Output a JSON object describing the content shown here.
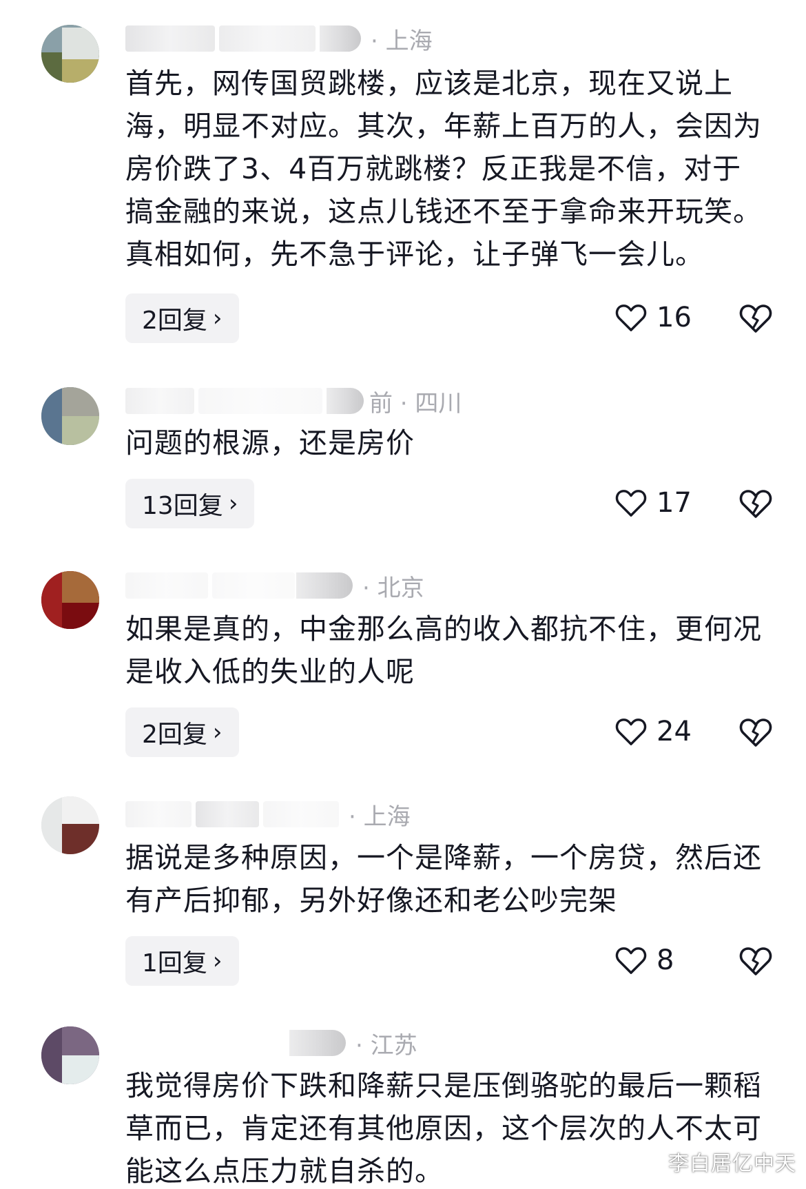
{
  "comments": [
    {
      "location": "· 上海",
      "text_lines": [
        "首先，网传国贸跳楼，应该是北京，现在又说上",
        "海，明显不对应。其次，年薪上百万的人，会因为",
        "房价跌了3、4百万就跳楼？反正我是不信，对于",
        "搞金融的来说，这点儿钱还不至于拿命来开玩笑。",
        "真相如何，先不急于评论，让子弹飞一会儿。"
      ],
      "reply_label": "2回复",
      "likes": "16"
    },
    {
      "location": "前 · 四川",
      "text_lines": [
        "问题的根源，还是房价"
      ],
      "reply_label": "13回复",
      "likes": "17"
    },
    {
      "location": "· 北京",
      "text_lines": [
        "如果是真的，中金那么高的收入都抗不住，更何况",
        "是收入低的失业的人呢"
      ],
      "reply_label": "2回复",
      "likes": "24"
    },
    {
      "location": "· 上海",
      "text_lines": [
        "据说是多种原因，一个是降薪，一个房贷，然后还",
        "有产后抑郁，另外好像还和老公吵完架"
      ],
      "reply_label": "1回复",
      "likes": "8"
    },
    {
      "location": "· 江苏",
      "text_lines": [
        "我觉得房价下跌和降薪只是压倒骆驼的最后一颗稻",
        "草而已，肯定还有其他原因，这个层次的人不太可",
        "能这么点压力就自杀的。"
      ]
    }
  ],
  "icons": {
    "reply_chevron": "chevron-right-icon",
    "like": "heart-outline-icon",
    "dislike": "broken-heart-icon"
  },
  "chevron_glyph": "›",
  "watermark": "李白居亿中天",
  "colors": {
    "text": "#161823",
    "meta": "#a9aab0",
    "reply_bg": "#f2f2f4"
  }
}
